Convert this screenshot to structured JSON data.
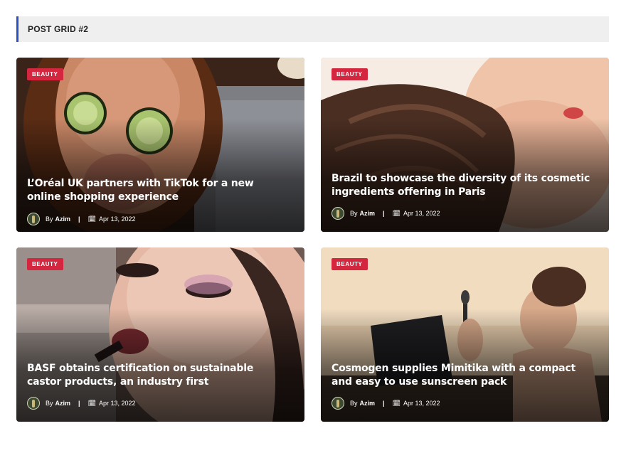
{
  "header": {
    "title": "POST GRID #2"
  },
  "posts": [
    {
      "category": "BEAUTY",
      "title": "L’Oréal UK partners with TikTok for a new online shopping experience",
      "author_prefix": "By",
      "author": "Azim",
      "separator": "|",
      "date": "Apr 13, 2022"
    },
    {
      "category": "BEAUTY",
      "title": "Brazil to showcase the diversity of its cosmetic ingredients offering in Paris",
      "author_prefix": "By",
      "author": "Azim",
      "separator": "|",
      "date": "Apr 13, 2022"
    },
    {
      "category": "BEAUTY",
      "title": "BASF obtains certification on sustainable castor products, an industry first",
      "author_prefix": "By",
      "author": "Azim",
      "separator": "|",
      "date": "Apr 13, 2022"
    },
    {
      "category": "BEAUTY",
      "title": "Cosmogen supplies Mimitika with a compact and easy to use sunscreen pack",
      "author_prefix": "By",
      "author": "Azim",
      "separator": "|",
      "date": "Apr 13, 2022"
    }
  ],
  "colors": {
    "accent": "#2950c5",
    "badge": "#d4263f",
    "header_bg": "#efefef"
  },
  "icons": {
    "date": "calendar-icon",
    "author": "avatar"
  }
}
